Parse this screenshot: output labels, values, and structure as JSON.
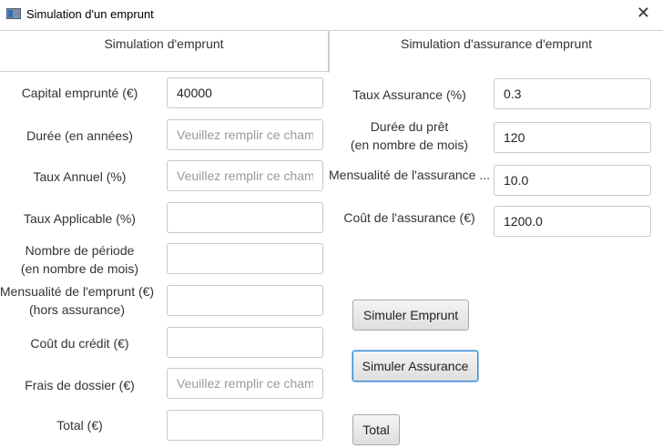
{
  "window": {
    "title": "Simulation d'un emprunt",
    "close_glyph": "✕"
  },
  "tabs": [
    {
      "label": "Simulation d'emprunt"
    },
    {
      "label": "Simulation d'assurance d'emprunt"
    }
  ],
  "loan_form": {
    "capital_label": "Capital emprunté (€)",
    "capital_value": "40000",
    "duree_label": "Durée (en années)",
    "duree_placeholder": "Veuillez remplir ce champ",
    "taux_annuel_label": "Taux Annuel (%)",
    "taux_annuel_placeholder": "Veuillez remplir ce champ",
    "taux_applicable_label": "Taux Applicable (%)",
    "nb_periode_label_1": "Nombre de période",
    "nb_periode_label_2": "(en nombre de mois)",
    "mensualite_label_1": "Mensualité de l'emprunt (€)",
    "mensualite_label_2": "(hors assurance)",
    "cout_credit_label": "Coût du crédit (€)",
    "frais_label": "Frais de dossier (€)",
    "frais_placeholder": "Veuillez remplir ce champ",
    "total_label": "Total (€)"
  },
  "insurance_form": {
    "taux_label": "Taux Assurance (%)",
    "taux_value": "0.3",
    "duree_label_1": "Durée du prêt",
    "duree_label_2": "(en nombre de mois)",
    "duree_value": "120",
    "mensualite_label": "Mensualité de l'assurance ...",
    "mensualite_value": "10.0",
    "cout_label": "Coût de l'assurance (€)",
    "cout_value": "1200.0"
  },
  "buttons": {
    "simuler_emprunt": "Simuler Emprunt",
    "simuler_assurance": "Simuler Assurance",
    "total": "Total"
  }
}
